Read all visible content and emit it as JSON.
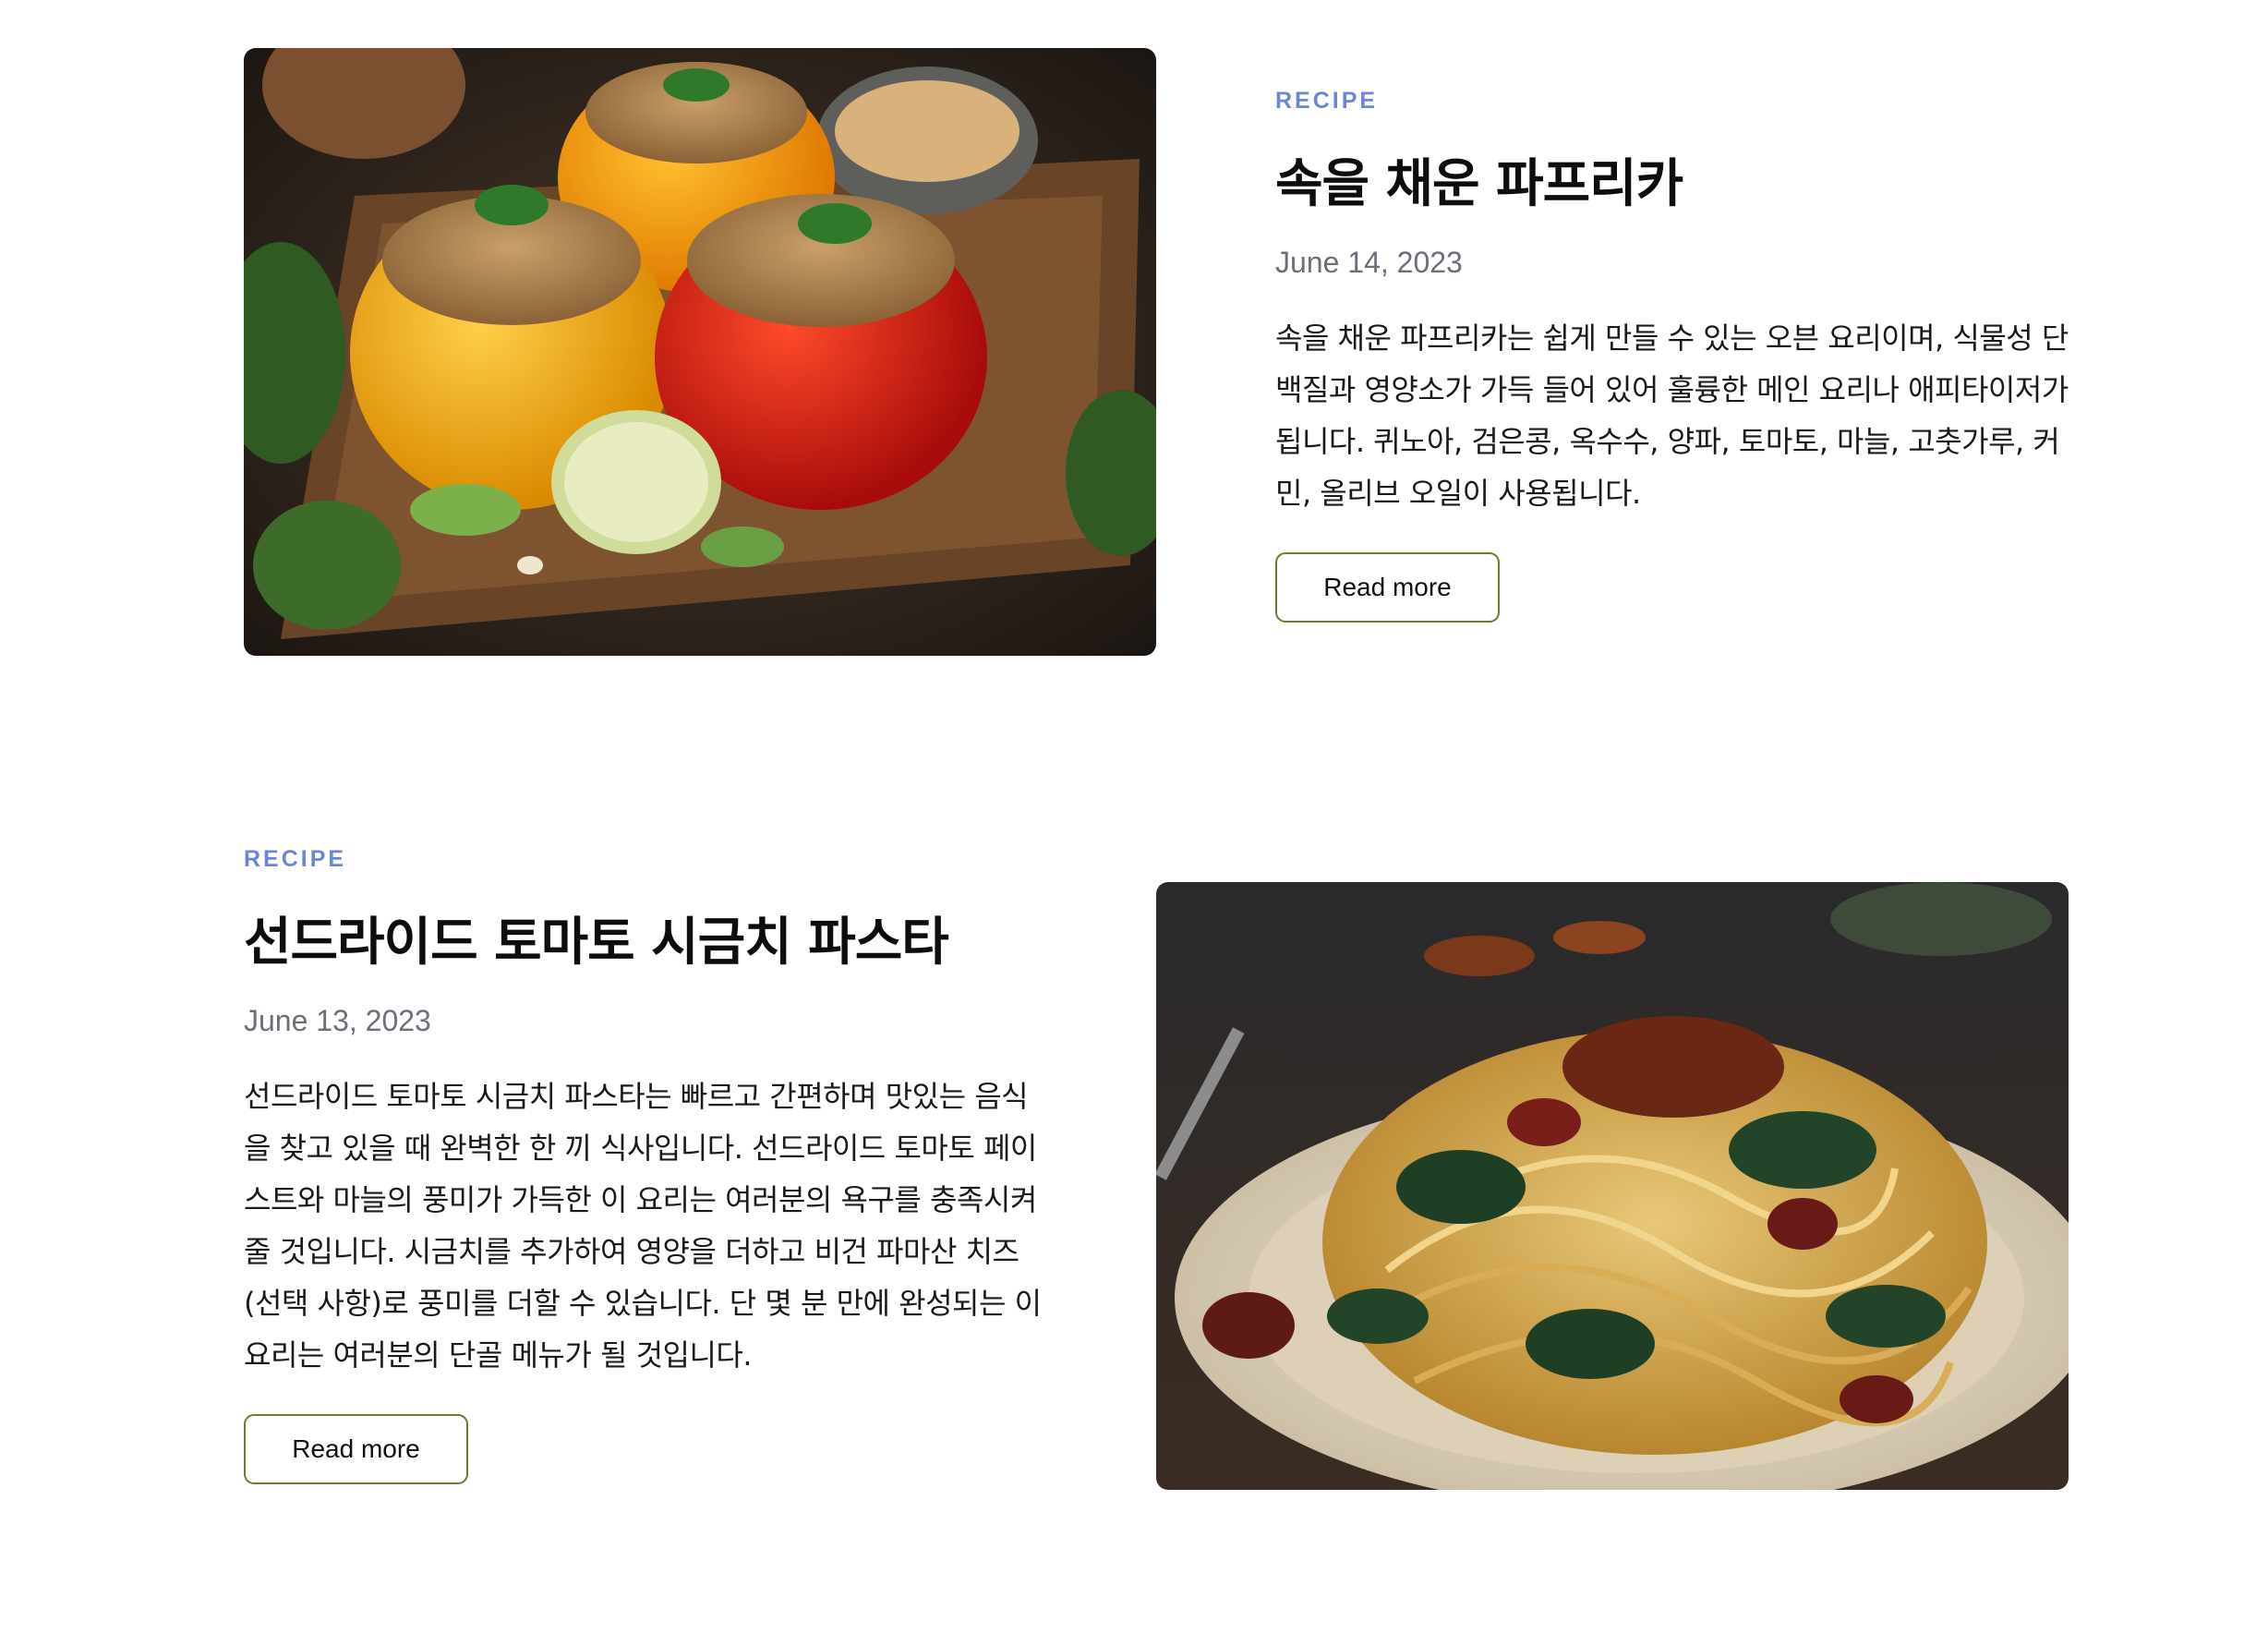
{
  "posts": [
    {
      "category": "RECIPE",
      "title": "속을 채운 파프리카",
      "date": "June 14, 2023",
      "excerpt": "속을 채운 파프리카는 쉽게 만들 수 있는 오븐 요리이며, 식물성 단백질과 영양소가 가득 들어 있어 훌륭한 메인 요리나 애피타이저가 됩니다. 퀴노아, 검은콩, 옥수수, 양파, 토마토, 마늘, 고춧가루, 커민, 올리브 오일이 사용됩니다.",
      "read_more": "Read more",
      "image": "stuffed-peppers-photo"
    },
    {
      "category": "RECIPE",
      "title": "선드라이드 토마토 시금치 파스타",
      "date": "June 13, 2023",
      "excerpt": "선드라이드 토마토 시금치 파스타는 빠르고 간편하며 맛있는 음식을 찾고 있을 때 완벽한 한 끼 식사입니다. 선드라이드 토마토 페이스트와 마늘의 풍미가 가득한 이 요리는 여러분의 욕구를 충족시켜줄 것입니다. 시금치를 추가하여 영양을 더하고 비건 파마산 치즈(선택 사항)로 풍미를 더할 수 있습니다. 단 몇 분 만에 완성되는 이 요리는 여러분의 단골 메뉴가 될 것입니다.",
      "read_more": "Read more",
      "image": "spinach-pasta-photo"
    }
  ],
  "colors": {
    "category": "#6b86d8",
    "button_border": "#6a7f2a",
    "date": "#6b6f7a"
  }
}
